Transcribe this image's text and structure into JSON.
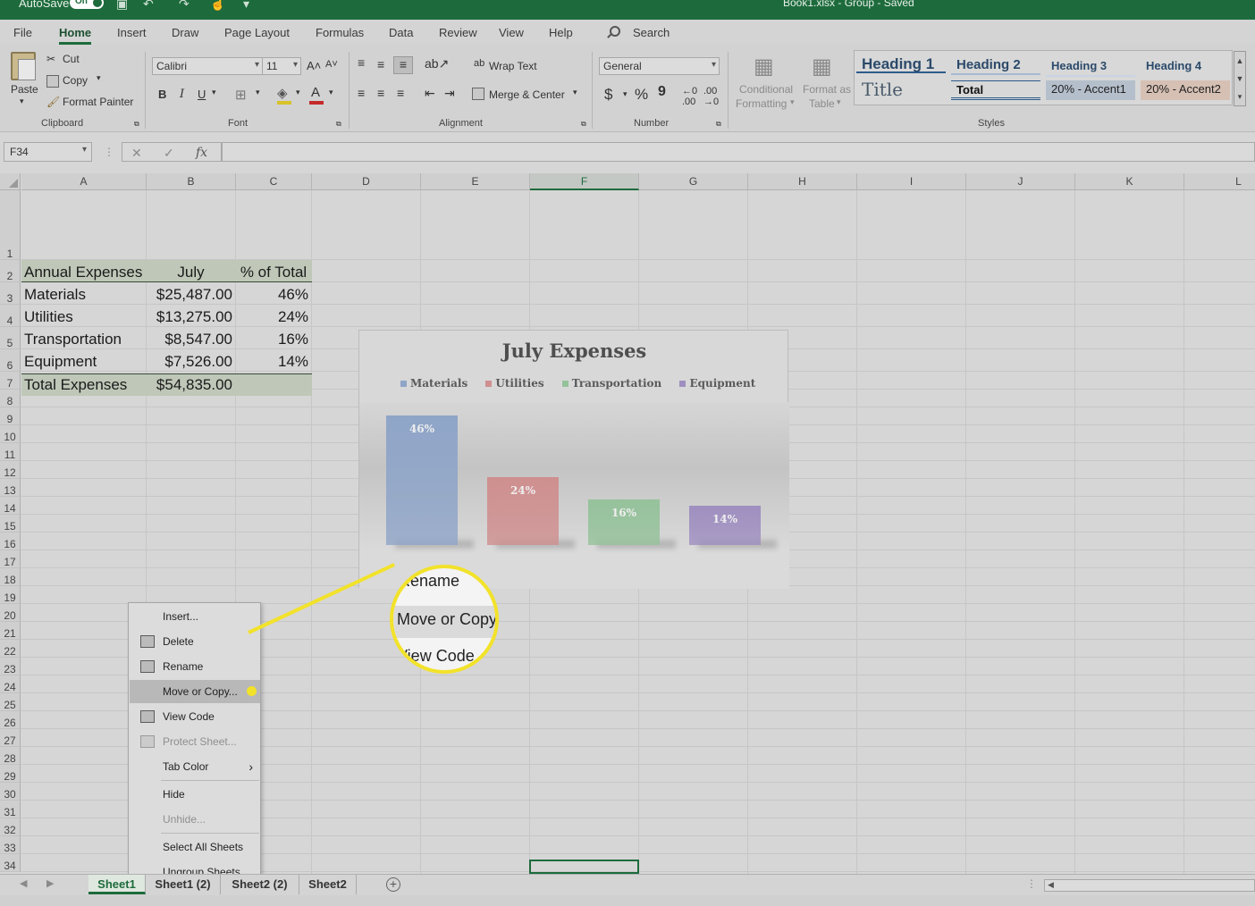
{
  "titlebar": {
    "autosave_label": "AutoSave",
    "autosave_state": "On",
    "document_title": "Book1.xlsx  -  Group  -  Saved"
  },
  "menu": {
    "tabs": [
      "File",
      "Home",
      "Insert",
      "Draw",
      "Page Layout",
      "Formulas",
      "Data",
      "Review",
      "View",
      "Help"
    ],
    "active_tab": "Home",
    "search_label": "Search"
  },
  "ribbon": {
    "clipboard": {
      "paste": "Paste",
      "cut": "Cut",
      "copy": "Copy",
      "format_painter": "Format Painter",
      "label": "Clipboard"
    },
    "font": {
      "name": "Calibri",
      "size": "11",
      "bold": "B",
      "italic": "I",
      "underline": "U",
      "label": "Font"
    },
    "alignment": {
      "wrap_text": "Wrap Text",
      "merge_center": "Merge & Center",
      "label": "Alignment"
    },
    "number": {
      "format": "General",
      "currency": "$",
      "percent": "%",
      "comma": "9",
      "label": "Number"
    },
    "styles": {
      "conditional_formatting_1": "Conditional",
      "conditional_formatting_2": "Formatting",
      "format_as_table_1": "Format as",
      "format_as_table_2": "Table",
      "heading1": "Heading 1",
      "heading2": "Heading 2",
      "heading3": "Heading 3",
      "heading4": "Heading 4",
      "title": "Title",
      "total": "Total",
      "accent1": "20% - Accent1",
      "accent2": "20% - Accent2",
      "label": "Styles"
    }
  },
  "formula_bar": {
    "name_box": "F34",
    "fx": "fx",
    "value": ""
  },
  "columns": [
    "A",
    "B",
    "C",
    "D",
    "E",
    "F",
    "G",
    "H",
    "I",
    "J",
    "K",
    "L"
  ],
  "selected_column": "F",
  "rows": [
    "1",
    "2",
    "3",
    "4",
    "5",
    "6",
    "7",
    "8",
    "9",
    "10",
    "11",
    "12",
    "13",
    "14",
    "15",
    "16",
    "17",
    "18",
    "19",
    "20",
    "21",
    "22",
    "23",
    "24",
    "25",
    "26",
    "27",
    "28",
    "29",
    "30",
    "31",
    "32",
    "33",
    "34"
  ],
  "table": {
    "header": [
      "Annual Expenses",
      "July",
      "% of Total"
    ],
    "rows": [
      [
        "Materials",
        "$25,487.00",
        "46%"
      ],
      [
        "Utilities",
        "$13,275.00",
        "24%"
      ],
      [
        "Transportation",
        "$8,547.00",
        "16%"
      ],
      [
        "Equipment",
        "$7,526.00",
        "14%"
      ]
    ],
    "total": [
      "Total Expenses",
      "$54,835.00",
      ""
    ]
  },
  "chart_data": {
    "type": "bar",
    "title": "July Expenses",
    "categories": [
      "Materials",
      "Utilities",
      "Transportation",
      "Equipment"
    ],
    "series": [
      {
        "name": "Materials",
        "values": [
          46
        ]
      },
      {
        "name": "Utilities",
        "values": [
          24
        ]
      },
      {
        "name": "Transportation",
        "values": [
          16
        ]
      },
      {
        "name": "Equipment",
        "values": [
          14
        ]
      }
    ],
    "values": [
      46,
      24,
      16,
      14
    ],
    "data_labels": [
      "46%",
      "24%",
      "16%",
      "14%"
    ],
    "colors": [
      "#8fa5c8",
      "#cf8f8f",
      "#95c29b",
      "#9f8fc0"
    ],
    "legend_position": "top",
    "grid": false,
    "ylim": [
      0,
      50
    ]
  },
  "context_menu": {
    "items": [
      {
        "label": "Insert...",
        "icon": "",
        "disabled": false
      },
      {
        "label": "Delete",
        "icon": "delete-sheet-icon",
        "disabled": false
      },
      {
        "label": "Rename",
        "icon": "rename-sheet-icon",
        "disabled": false
      },
      {
        "label": "Move or Copy...",
        "icon": "",
        "disabled": false,
        "highlighted": true
      },
      {
        "label": "View Code",
        "icon": "view-code-icon",
        "disabled": false
      },
      {
        "label": "Protect Sheet...",
        "icon": "protect-sheet-icon",
        "disabled": true
      },
      {
        "label": "Tab Color",
        "icon": "",
        "disabled": false,
        "submenu": true
      },
      {
        "label": "Hide",
        "icon": "",
        "disabled": false
      },
      {
        "label": "Unhide...",
        "icon": "",
        "disabled": true
      },
      {
        "label": "Select All Sheets",
        "icon": "",
        "disabled": false
      },
      {
        "label": "Ungroup Sheets",
        "icon": "",
        "disabled": false
      }
    ]
  },
  "zoom_callout": {
    "line1": "Rename",
    "line2": "Move or Copy",
    "line3": "View Code",
    "accent_color": "#f2e22a"
  },
  "sheet_tabs": [
    "Sheet1",
    "Sheet1 (2)",
    "Sheet2 (2)",
    "Sheet2"
  ],
  "active_sheet": "Sheet1"
}
